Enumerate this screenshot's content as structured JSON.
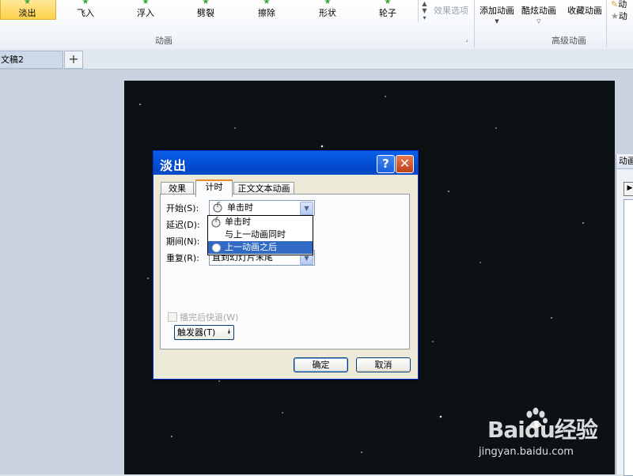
{
  "ribbon": {
    "effects": [
      {
        "label": "淡出",
        "selected": true
      },
      {
        "label": "飞入"
      },
      {
        "label": "浮入"
      },
      {
        "label": "劈裂"
      },
      {
        "label": "擦除"
      },
      {
        "label": "形状"
      },
      {
        "label": "轮子"
      }
    ],
    "effect_options_label": "效果选项",
    "group_animation_label": "动画",
    "advanced": {
      "add_animation": "添加动画",
      "cool_animation": "酷炫动画",
      "favorite_animation": "收藏动画",
      "group_label": "高级动画",
      "partial_1": "动",
      "partial_2": "动"
    }
  },
  "doc_tabs": {
    "active": "文稿2",
    "new_tab": "+"
  },
  "animation_pane": {
    "header": "动画",
    "play_label": "▶"
  },
  "dialog": {
    "title": "淡出",
    "help_label": "?",
    "close_label": "✕",
    "tabs": [
      {
        "label": "效果"
      },
      {
        "label": "计时",
        "active": true
      },
      {
        "label": "正文文本动画"
      }
    ],
    "start": {
      "label": "开始(S):",
      "value": "单击时"
    },
    "delay": {
      "label": "延迟(D):"
    },
    "duration": {
      "label": "期间(N):"
    },
    "repeat": {
      "label": "重复(R):",
      "value": "直到幻灯片末尾"
    },
    "dropdown_options": [
      {
        "label": "单击时"
      },
      {
        "label": "与上一动画同时"
      },
      {
        "label": "上一动画之后",
        "selected": true
      }
    ],
    "rewind_label": "播完后快退(W)",
    "trigger_label": "触发器(T)",
    "ok_label": "确定",
    "cancel_label": "取消"
  },
  "watermark": {
    "brand": "Baidu经验",
    "url": "jingyan.baidu.com"
  },
  "colors": {
    "titlebar": "#0553d9",
    "selection": "#316ac5",
    "slide_bg": "#0c1114",
    "effect_selected": "#ffd24a"
  }
}
